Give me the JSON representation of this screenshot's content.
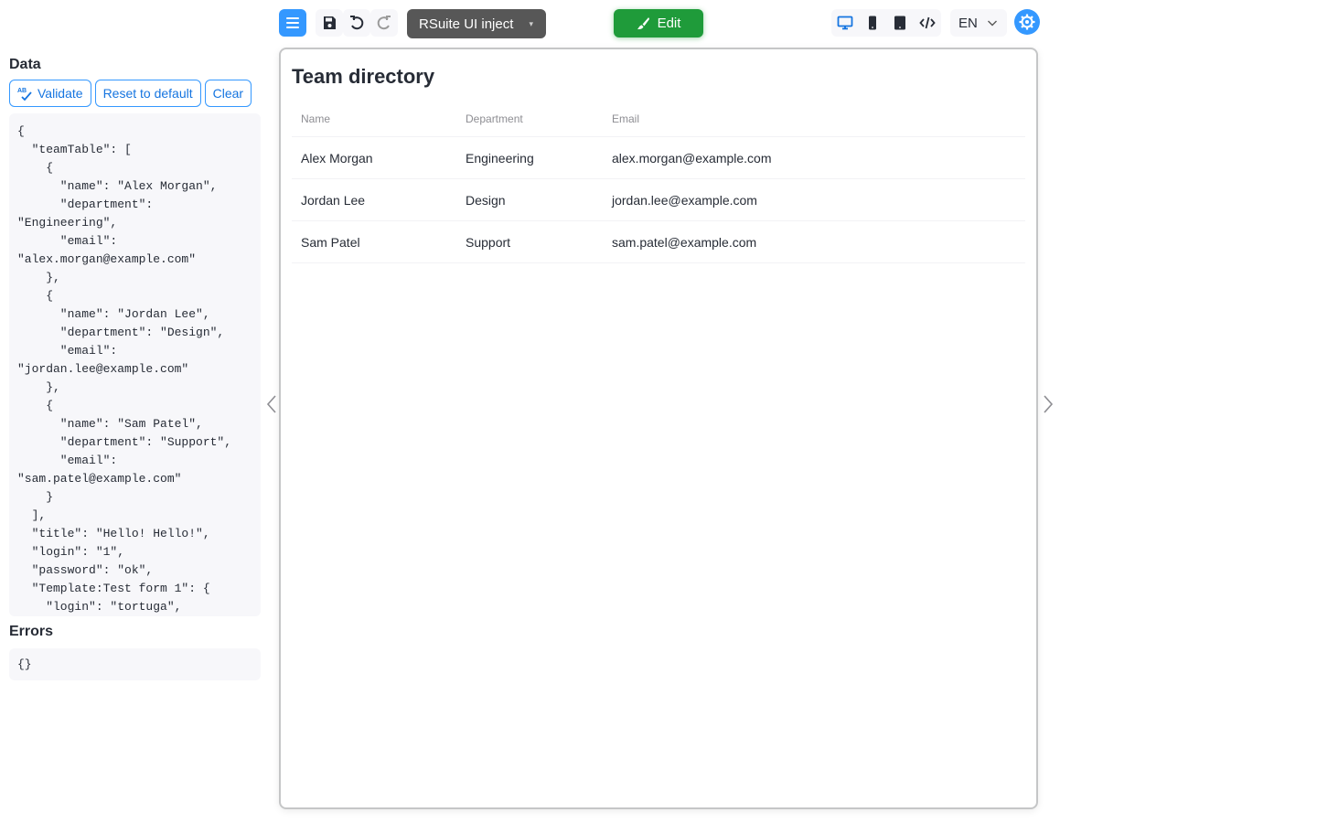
{
  "toolbar": {
    "template_select": "RSuite UI inject",
    "edit_label": "Edit",
    "language": "EN",
    "icons": {
      "menu": "menu-icon",
      "save": "save-icon",
      "undo": "undo-icon",
      "redo": "redo-icon",
      "desktop": "desktop-icon",
      "tablet": "tablet-icon",
      "mobile": "mobile-icon",
      "code": "code-icon",
      "settings": "settings-icon"
    },
    "colors": {
      "accent": "#3498ff",
      "edit": "#1f9b3a",
      "select_bg": "#575757"
    }
  },
  "data_panel": {
    "title": "Data",
    "validate_label": "Validate",
    "reset_label": "Reset to default",
    "clear_label": "Clear",
    "json_text": "{\n  \"teamTable\": [\n    {\n      \"name\": \"Alex Morgan\",\n      \"department\":\n\"Engineering\",\n      \"email\":\n\"alex.morgan@example.com\"\n    },\n    {\n      \"name\": \"Jordan Lee\",\n      \"department\": \"Design\",\n      \"email\":\n\"jordan.lee@example.com\"\n    },\n    {\n      \"name\": \"Sam Patel\",\n      \"department\": \"Support\",\n      \"email\":\n\"sam.patel@example.com\"\n    }\n  ],\n  \"title\": \"Hello! Hello!\",\n  \"login\": \"1\",\n  \"password\": \"ok\",\n  \"Template:Test form 1\": {\n    \"login\": \"tortuga\","
  },
  "errors_panel": {
    "title": "Errors",
    "text": "{}"
  },
  "preview": {
    "title": "Team directory",
    "columns": [
      "Name",
      "Department",
      "Email"
    ],
    "rows": [
      [
        "Alex Morgan",
        "Engineering",
        "alex.morgan@example.com"
      ],
      [
        "Jordan Lee",
        "Design",
        "jordan.lee@example.com"
      ],
      [
        "Sam Patel",
        "Support",
        "sam.patel@example.com"
      ]
    ]
  }
}
